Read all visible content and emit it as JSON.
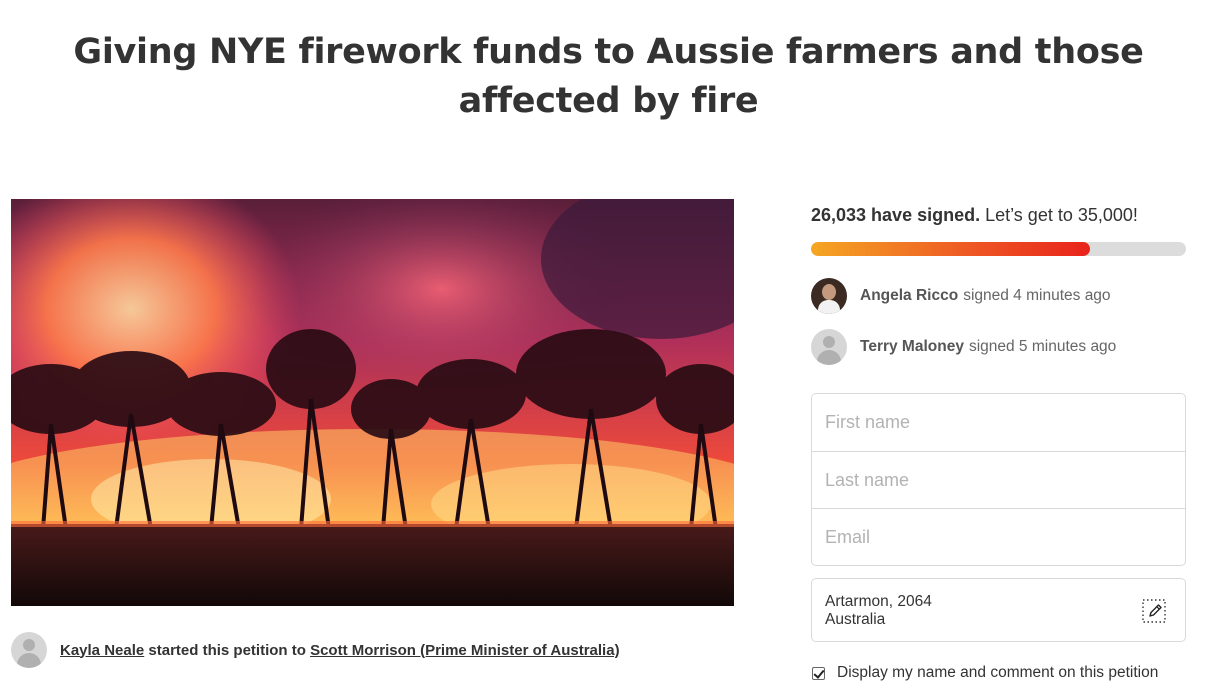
{
  "petition": {
    "title": "Giving NYE firework funds to Aussie farmers and those affected by fire",
    "image_alt": "bushfire"
  },
  "starter": {
    "name": "Kayla Neale",
    "connector": "started this petition to",
    "target": "Scott Morrison (Prime Minister of Australia)"
  },
  "signatures": {
    "count_text": "26,033 have signed.",
    "goal_text": "Let’s get to 35,000!",
    "count": 26033,
    "goal": 35000,
    "progress_fraction": 0.744,
    "colors": {
      "bar_start": "#f5a623",
      "bar_end": "#e8231b",
      "track": "#dcdcdc"
    }
  },
  "recent_signers": [
    {
      "name": "Angela Ricco",
      "action": "signed 4 minutes ago",
      "avatar": "photo"
    },
    {
      "name": "Terry Maloney",
      "action": "signed 5 minutes ago",
      "avatar": "generic-user-icon"
    }
  ],
  "form": {
    "first_name_placeholder": "First name",
    "last_name_placeholder": "Last name",
    "email_placeholder": "Email",
    "location_line1": "Artarmon, 2064",
    "location_line2": "Australia",
    "display_option_label": "Display my name and comment on this petition",
    "display_option_checked": true
  }
}
